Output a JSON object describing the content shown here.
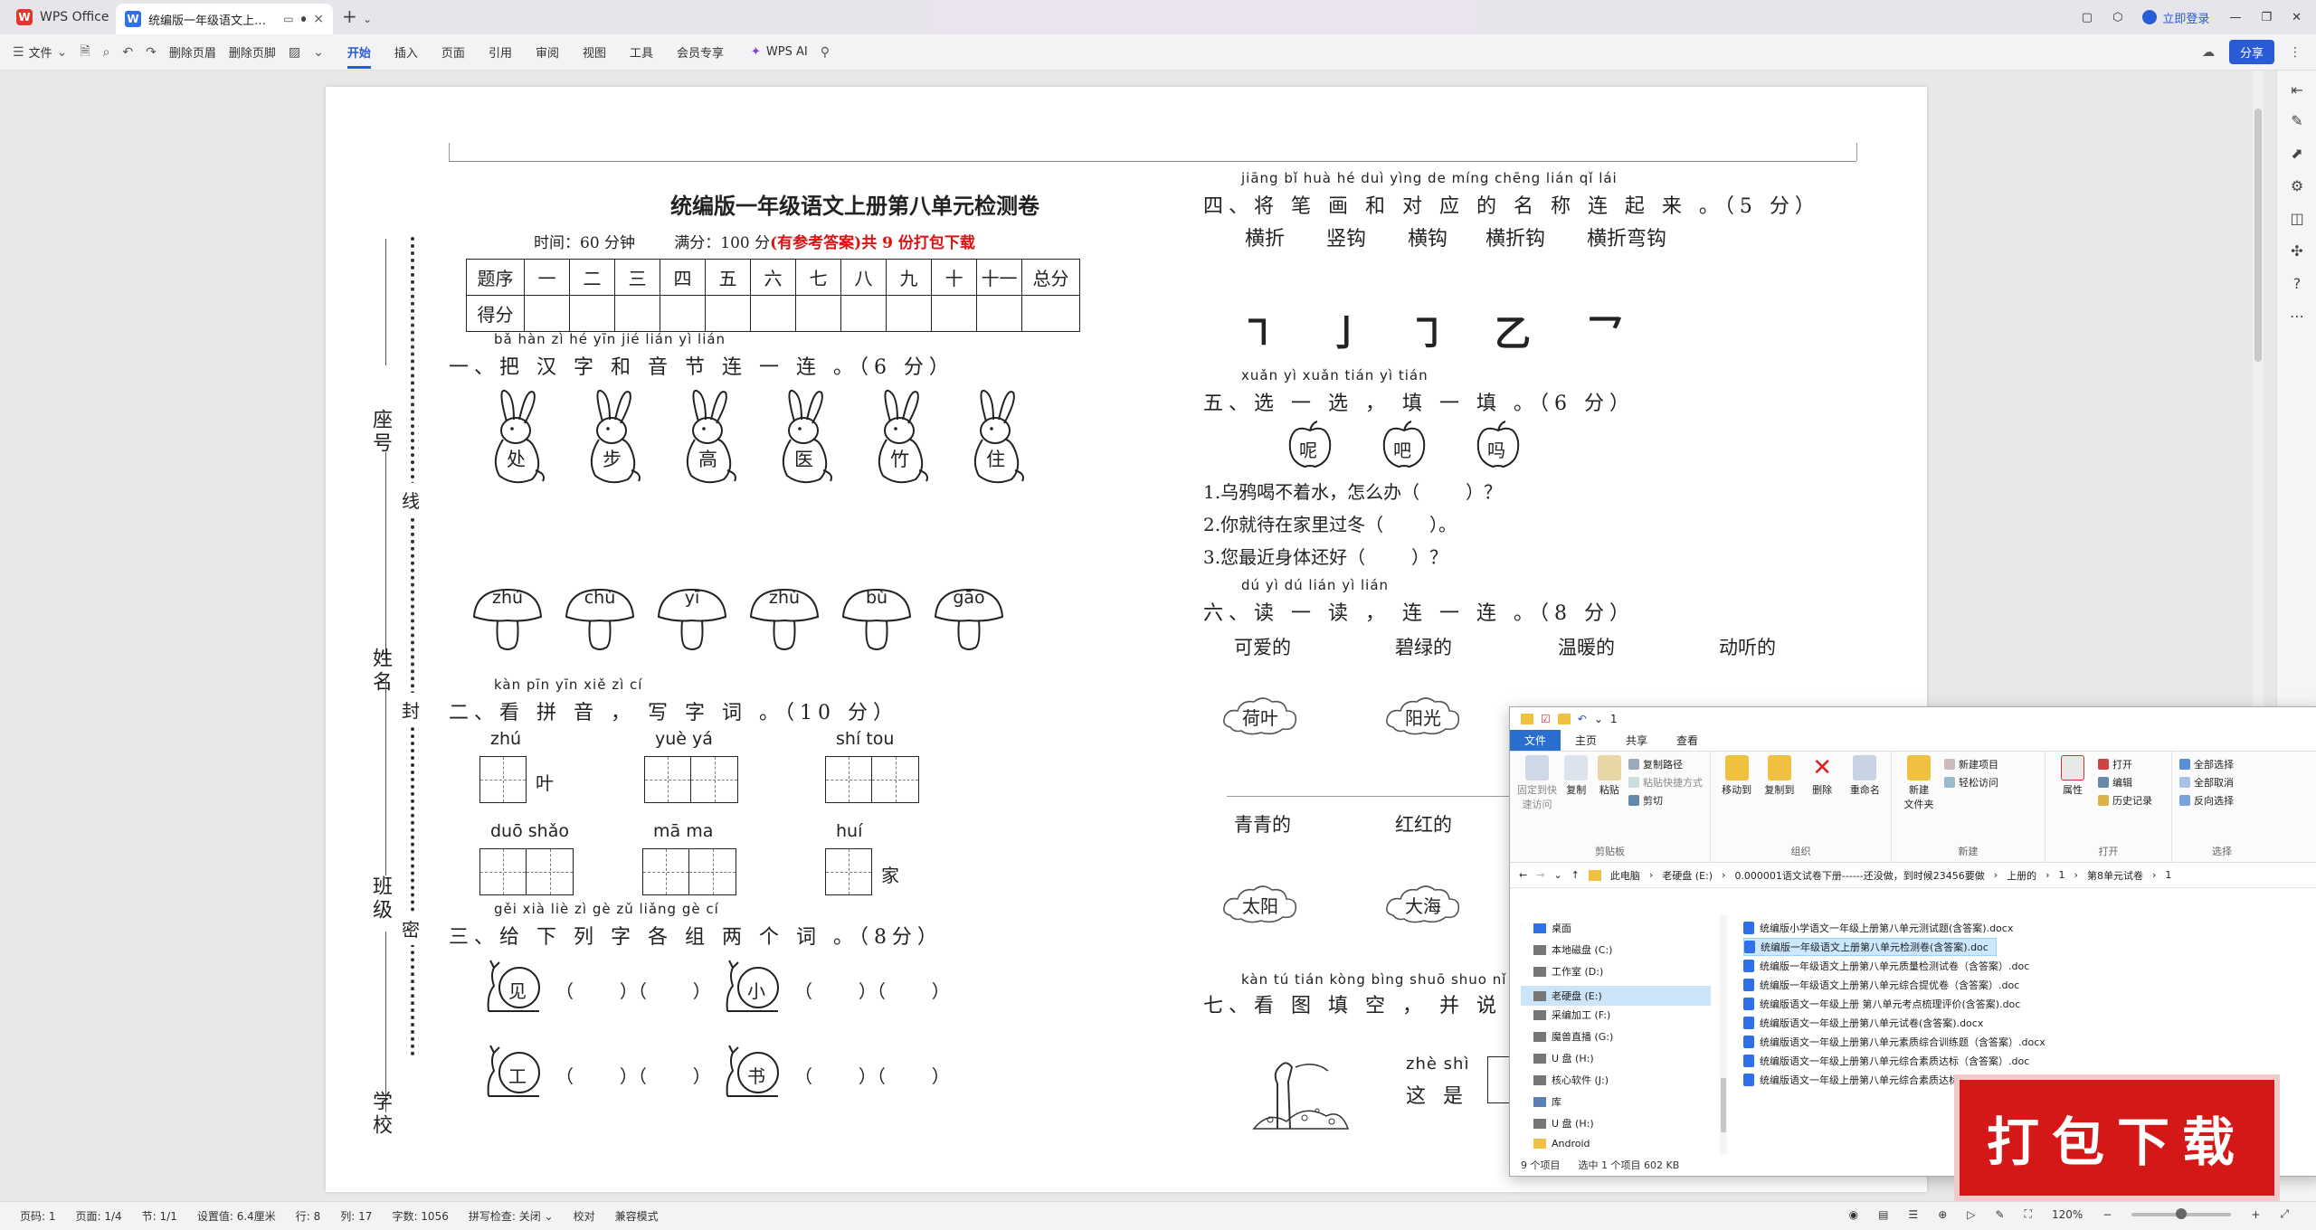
{
  "app": {
    "name": "WPS Office",
    "doc_tab_title": "统编版一年级语文上册第八单元检测卷(含答案)",
    "login": "立即登录"
  },
  "toolbar": {
    "file": "文件",
    "delete_header": "删除页眉",
    "delete_footer": "删除页脚",
    "tabs": [
      "开始",
      "插入",
      "页面",
      "引用",
      "审阅",
      "视图",
      "工具",
      "会员专享"
    ],
    "wps_ai": "WPS AI",
    "share": "分享"
  },
  "doc": {
    "title": "统编版一年级语文上册第八单元检测卷",
    "time": "时间：60 分钟",
    "full_score": "满分：100 分",
    "promo": "(有参考答案)共 9 份打包下载",
    "score_table": {
      "header": [
        "题序",
        "一",
        "二",
        "三",
        "四",
        "五",
        "六",
        "七",
        "八",
        "九",
        "十",
        "十一",
        "总分"
      ],
      "row_label": "得分"
    },
    "binding": {
      "labels": [
        "座号",
        "姓名",
        "班级",
        "学校"
      ],
      "words": [
        "线",
        "封",
        "密"
      ]
    },
    "q1": {
      "pinyin": "bǎ hàn zì  hé  yīn jié lián yì lián",
      "text": "一、把 汉 字 和 音 节 连 一 连 。（6 分）",
      "rabbits": [
        "处",
        "步",
        "高",
        "医",
        "竹",
        "住"
      ],
      "mushrooms": [
        "zhú",
        "chù",
        "yī",
        "zhù",
        "bù",
        "gāo"
      ]
    },
    "q2": {
      "pinyin": "kàn pīn yīn    xiě  zì  cí",
      "text": "二、看 拼 音 ， 写 字 词 。（10 分）",
      "items": [
        {
          "py": "zhú",
          "after": "叶"
        },
        {
          "py": "yuè   yá",
          "after": ""
        },
        {
          "py": "shí   tou",
          "after": ""
        },
        {
          "py": "duō  shǎo",
          "after": ""
        },
        {
          "py": "mā    ma",
          "after": ""
        },
        {
          "py": "huí",
          "after": "家"
        }
      ]
    },
    "q3": {
      "pinyin": "gěi xià liè zì  gè zǔ liǎng gè cí",
      "text": "三、给 下 列 字 各 组 两 个 词 。（8分）",
      "snails": [
        "见",
        "小",
        "工",
        "书"
      ],
      "blanks": "（        ）（        ）"
    },
    "q4": {
      "pinyin": "jiāng bǐ  huà  hé  duì yìng de míng chēng lián qǐ  lái",
      "text": "四、将 笔 画 和 对 应 的 名 称 连 起 来 。（5 分）",
      "names": [
        "横折",
        "竖钩",
        "横钩",
        "横折钩",
        "横折弯钩"
      ],
      "strokes": [
        "㇕",
        "亅",
        "㇆",
        "乙",
        "乛"
      ]
    },
    "q5": {
      "pinyin": "xuǎn yì xuǎn    tián yì tián",
      "text": "五、选 一 选 ， 填 一 填 。（6 分）",
      "apples": [
        "呢",
        "吧",
        "吗"
      ],
      "sentences": [
        "1.乌鸦喝不着水，怎么办（        ）？",
        "2.你就待在家里过冬（        ）。",
        "3.您最近身体还好（        ）？"
      ]
    },
    "q6": {
      "pinyin": "dú  yì  dú     lián yì lián",
      "text": "六、读 一 读 ， 连 一 连 。（8 分）",
      "top_words": [
        "可爱的",
        "碧绿的",
        "温暖的",
        "动听的"
      ],
      "clouds_top": [
        "荷叶",
        "阳光"
      ],
      "bottom_words": [
        "青青的",
        "红红的"
      ],
      "clouds_bottom": [
        "太阳",
        "大海"
      ]
    },
    "q7": {
      "pinyin": "kàn tú tián kòng    bìng shuō shuo nǐ  zuì  xǐ",
      "text": "七、看 图 填 空 ， 并 说 说 你 最",
      "pinyin2": "zhè shì",
      "text2": "这   是"
    }
  },
  "explorer": {
    "qa_title": "1",
    "tabs": [
      "文件",
      "主页",
      "共享",
      "查看"
    ],
    "ribbon": {
      "clipboard": {
        "pin": "固定到快\n速访问",
        "copy": "复制",
        "paste": "粘贴",
        "copy_path": "复制路径",
        "paste_shortcut": "粘贴快捷方式",
        "cut": "剪切",
        "label": "剪贴板"
      },
      "organize": {
        "move": "移动到",
        "copyto": "复制到",
        "delete": "删除",
        "rename": "重命名",
        "label": "组织"
      },
      "new": {
        "new_folder": "新建\n文件夹",
        "new_item": "新建项目",
        "easy_access": "轻松访问",
        "label": "新建"
      },
      "open": {
        "props": "属性",
        "open": "打开",
        "edit": "编辑",
        "history": "历史记录",
        "label": "打开"
      },
      "select": {
        "all": "全部选择",
        "none": "全部取消",
        "invert": "反向选择",
        "label": "选择"
      }
    },
    "breadcrumb": [
      "此电脑",
      "老硬盘 (E:)",
      "0.000001语文试卷下册------还没做，到时候23456要做",
      "上册的",
      "1",
      "第8单元试卷",
      "1"
    ],
    "nav": [
      "桌面",
      "本地磁盘 (C:)",
      "工作室 (D:)",
      "老硬盘 (E:)",
      "采编加工 (F:)",
      "魔兽直播 (G:)",
      "U 盘 (H:)",
      "核心软件 (J:)",
      "库",
      "U 盘 (H:)",
      "Android"
    ],
    "files": [
      "统编版小学语文一年级上册第八单元测试题(含答案).docx",
      "统编版一年级语文上册第八单元检测卷(含答案).doc",
      "统编版一年级语文上册第八单元质量检测试卷（含答案）.doc",
      "统编版一年级语文上册第八单元综合提优卷（含答案）.doc",
      "统编版语文一年级上册 第八单元考点梳理评价(含答案).doc",
      "统编版语文一年级上册第八单元试卷(含答案).docx",
      "统编版语文一年级上册第八单元素质综合训练题（含答案）.docx",
      "统编版语文一年级上册第八单元综合素质达标（含答案）.doc",
      "统编版语文一年级上册第八单元综合素质达标（含答案）.doc"
    ],
    "status": {
      "count": "9 个项目",
      "selected": "选中 1 个项目  602 KB"
    }
  },
  "badge": "打包下载",
  "statusbar": {
    "page_code": "页码: 1",
    "pages": "页面: 1/4",
    "section": "节: 1/1",
    "setting": "设置值: 6.4厘米",
    "row": "行: 8",
    "col": "列: 17",
    "words": "字数: 1056",
    "spell": "拼写检查: 关闭",
    "proof": "校对",
    "compat": "兼容模式",
    "zoom": "120%",
    "zoom_level": 0.5
  }
}
